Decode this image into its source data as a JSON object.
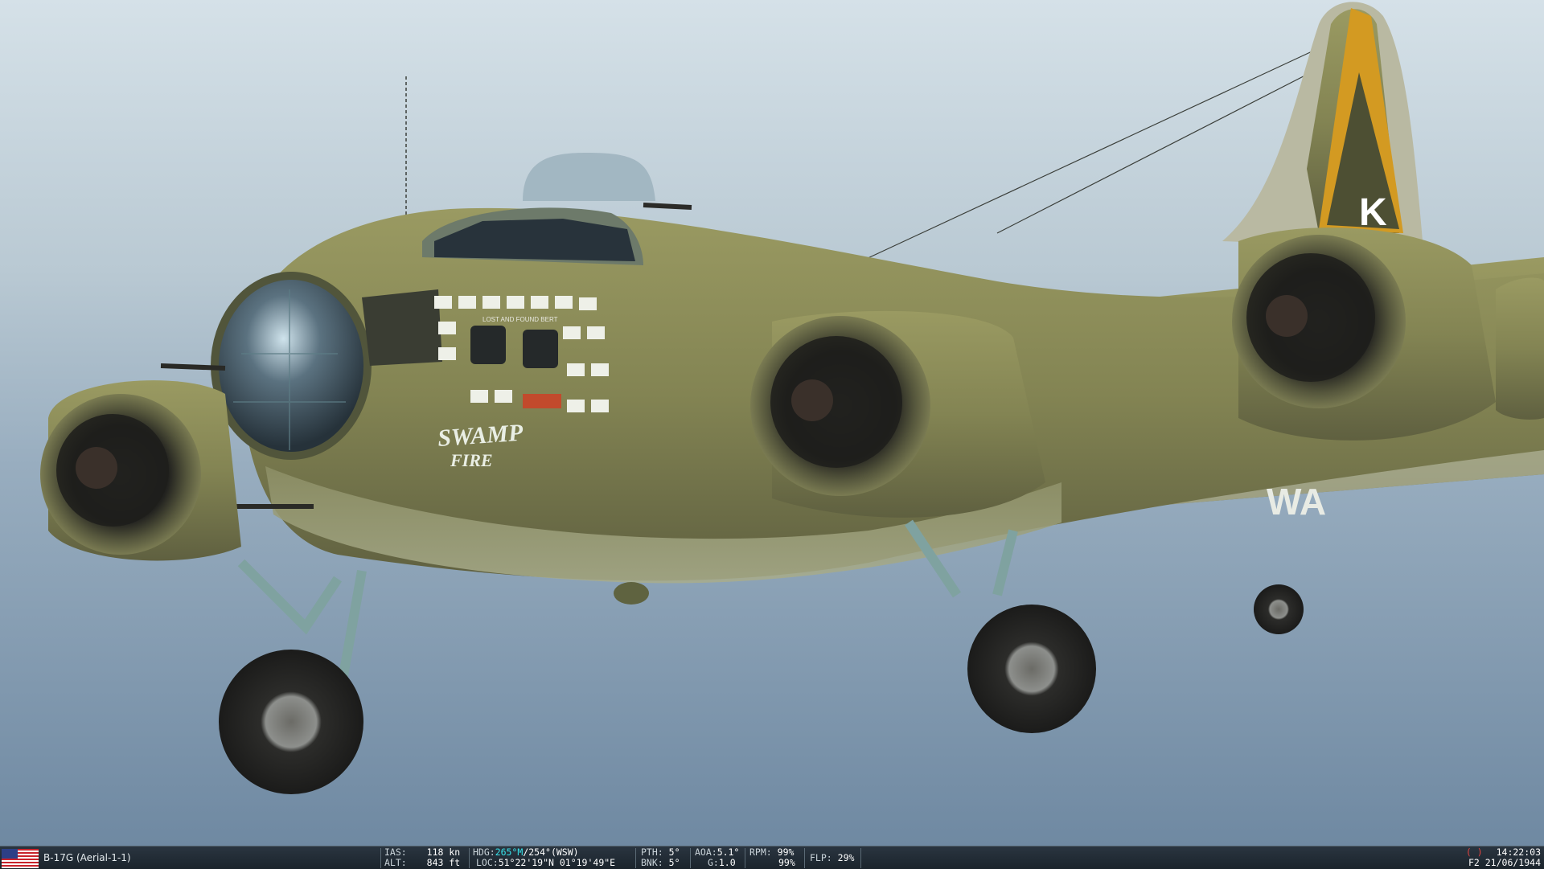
{
  "colors": {
    "sky_top": "#cfdde6",
    "sky_bottom": "#7c95ad",
    "olive_drab": "#8a8a55",
    "olive_dark": "#5d5e38",
    "tail_yellow": "#d39a22",
    "statusbar_bg": "#222c35",
    "highlight": "#36e0e8",
    "warning": "#e0433f"
  },
  "aircraft": {
    "nose_art_line1": "SWAMP",
    "nose_art_line2": "FIRE",
    "small_nose_text": "LOST AND FOUND BERT",
    "tail_letter": "K",
    "fuselage_code": "WA"
  },
  "statusbar": {
    "flag_icon": "usa-flag-icon",
    "unit": "B-17G (Aerial-1-1)",
    "ias_label": "IAS:",
    "ias_value": "118",
    "ias_unit": "kn",
    "alt_label": "ALT:",
    "alt_value": "843",
    "alt_unit": "ft",
    "hdg_label": "HDG:",
    "hdg_magnetic": "265°M",
    "hdg_true": "/254°(WSW)",
    "loc_label": "LOC:",
    "loc_value": "51°22'19\"N 01°19'49\"E",
    "pth_label": "PTH:",
    "pth_value": "5°",
    "bnk_label": "BNK:",
    "bnk_value": "5°",
    "aoa_label": "AOA:",
    "aoa_value": "5.1°",
    "g_label": "G:",
    "g_value": "1.0",
    "rpm_label": "RPM:",
    "rpm_value1": "99%",
    "rpm_value2": "99%",
    "flp_label": "FLP:",
    "flp_value": "29%",
    "paren_indicator": "( )",
    "time": "14:22:03",
    "fkey_date": "F2 21/06/1944"
  }
}
